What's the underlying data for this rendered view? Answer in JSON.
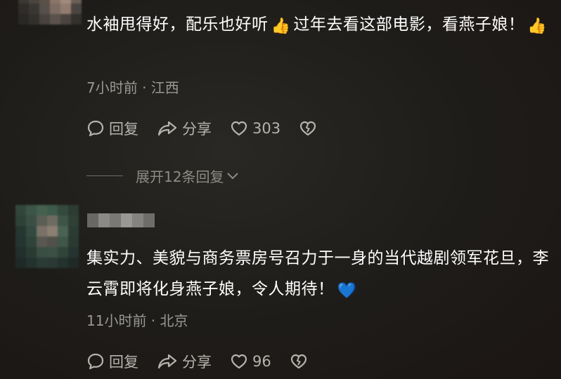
{
  "comments": [
    {
      "text_parts": [
        "水袖甩得好，配乐也好听",
        "过年去看这部电影，看燕子娘！"
      ],
      "emoji": [
        "thumbs-up",
        "thumbs-up"
      ],
      "meta": "7小时前 · 江西",
      "reply_label": "回复",
      "share_label": "分享",
      "like_count": "303",
      "expand_label": "展开12条回复"
    },
    {
      "text": "集实力、美貌与商务票房号召力于一身的当代越剧领军花旦，李云霄即将化身燕子娘，令人期待！",
      "emoji": [
        "blue-heart"
      ],
      "meta": "11小时前 · 北京",
      "reply_label": "回复",
      "share_label": "分享",
      "like_count": "96"
    }
  ],
  "colors": {
    "background": "#1e1c19",
    "text": "#ffffff",
    "meta": "#9a9893",
    "action": "#b5b3ae"
  }
}
